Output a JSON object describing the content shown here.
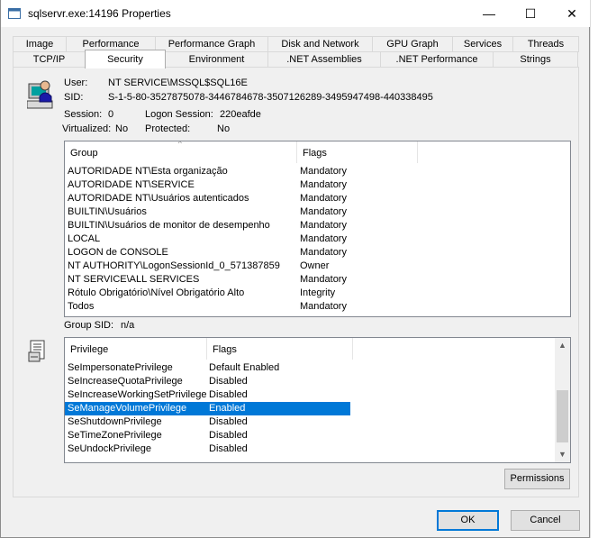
{
  "window": {
    "title": "sqlservr.exe:14196 Properties",
    "minimize_glyph": "—",
    "maximize_glyph": "☐",
    "close_glyph": "✕"
  },
  "tabs_top": [
    "Image",
    "Performance",
    "Performance Graph",
    "Disk and Network",
    "GPU Graph",
    "Services",
    "Threads"
  ],
  "tabs_bottom": [
    "TCP/IP",
    "Security",
    "Environment",
    ".NET Assemblies",
    ".NET Performance",
    "Strings"
  ],
  "active_tab": "Security",
  "security": {
    "user_label": "User:",
    "user_value": "NT SERVICE\\MSSQL$SQL16E",
    "sid_label": "SID:",
    "sid_value": "S-1-5-80-3527875078-3446784678-3507126289-3495947498-440338495",
    "session_label": "Session:",
    "session_value": "0",
    "logon_session_label": "Logon Session:",
    "logon_session_value": "220eafde",
    "virtualized_label": "Virtualized:",
    "virtualized_value": "No",
    "protected_label": "Protected:",
    "protected_value": "No"
  },
  "groups": {
    "columns": [
      "Group",
      "Flags"
    ],
    "rows": [
      {
        "group": "AUTORIDADE NT\\Esta organização",
        "flags": "Mandatory"
      },
      {
        "group": "AUTORIDADE NT\\SERVICE",
        "flags": "Mandatory"
      },
      {
        "group": "AUTORIDADE NT\\Usuários autenticados",
        "flags": "Mandatory"
      },
      {
        "group": "BUILTIN\\Usuários",
        "flags": "Mandatory"
      },
      {
        "group": "BUILTIN\\Usuários de monitor de desempenho",
        "flags": "Mandatory"
      },
      {
        "group": "LOCAL",
        "flags": "Mandatory"
      },
      {
        "group": "LOGON de CONSOLE",
        "flags": "Mandatory"
      },
      {
        "group": "NT AUTHORITY\\LogonSessionId_0_571387859",
        "flags": "Owner"
      },
      {
        "group": "NT SERVICE\\ALL SERVICES",
        "flags": "Mandatory"
      },
      {
        "group": "Rótulo Obrigatório\\Nível Obrigatório Alto",
        "flags": "Integrity"
      },
      {
        "group": "Todos",
        "flags": "Mandatory"
      }
    ],
    "group_sid_label": "Group SID:",
    "group_sid_value": "n/a"
  },
  "privileges": {
    "columns": [
      "Privilege",
      "Flags"
    ],
    "rows": [
      {
        "privilege": "SeImpersonatePrivilege",
        "flags": "Default Enabled"
      },
      {
        "privilege": "SeIncreaseQuotaPrivilege",
        "flags": "Disabled"
      },
      {
        "privilege": "SeIncreaseWorkingSetPrivilege",
        "flags": "Disabled"
      },
      {
        "privilege": "SeManageVolumePrivilege",
        "flags": "Enabled"
      },
      {
        "privilege": "SeShutdownPrivilege",
        "flags": "Disabled"
      },
      {
        "privilege": "SeTimeZonePrivilege",
        "flags": "Disabled"
      },
      {
        "privilege": "SeUndockPrivilege",
        "flags": "Disabled"
      }
    ],
    "selected_index": 3,
    "scroll_position": 0.9
  },
  "buttons": {
    "permissions": "Permissions",
    "ok": "OK",
    "cancel": "Cancel"
  },
  "colors": {
    "selection": "#0078d7",
    "accent": "#0078d7"
  }
}
